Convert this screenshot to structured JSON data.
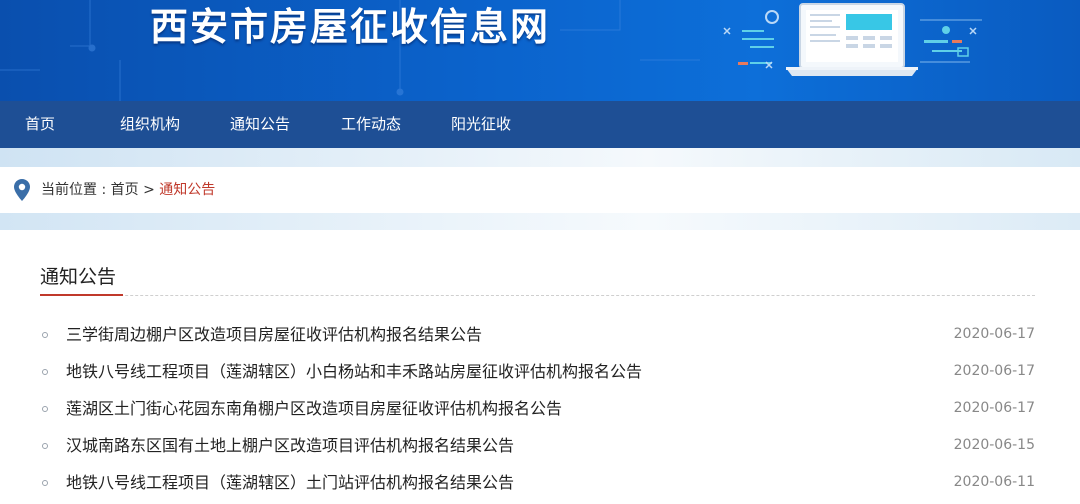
{
  "header": {
    "site_title": "西安市房屋征收信息网",
    "brand_color": "#0b63cc"
  },
  "nav": {
    "items": [
      {
        "label": "首页"
      },
      {
        "label": "组织机构"
      },
      {
        "label": "通知公告"
      },
      {
        "label": "工作动态"
      },
      {
        "label": "阳光征收"
      }
    ],
    "background": "#1e4f95"
  },
  "breadcrumb": {
    "prefix": "当前位置 : ",
    "home": "首页",
    "separator": " > ",
    "current": "通知公告",
    "icon": "location-pin-icon",
    "accent": "#c0392b"
  },
  "section": {
    "title": "通知公告",
    "items": [
      {
        "title": "三学街周边棚户区改造项目房屋征收评估机构报名结果公告",
        "date": "2020-06-17"
      },
      {
        "title": "地铁八号线工程项目（莲湖辖区）小白杨站和丰禾路站房屋征收评估机构报名公告",
        "date": "2020-06-17"
      },
      {
        "title": "莲湖区土门街心花园东南角棚户区改造项目房屋征收评估机构报名公告",
        "date": "2020-06-17"
      },
      {
        "title": "汉城南路东区国有土地上棚户区改造项目评估机构报名结果公告",
        "date": "2020-06-15"
      },
      {
        "title": "地铁八号线工程项目（莲湖辖区）土门站评估机构报名结果公告",
        "date": "2020-06-11"
      }
    ]
  }
}
